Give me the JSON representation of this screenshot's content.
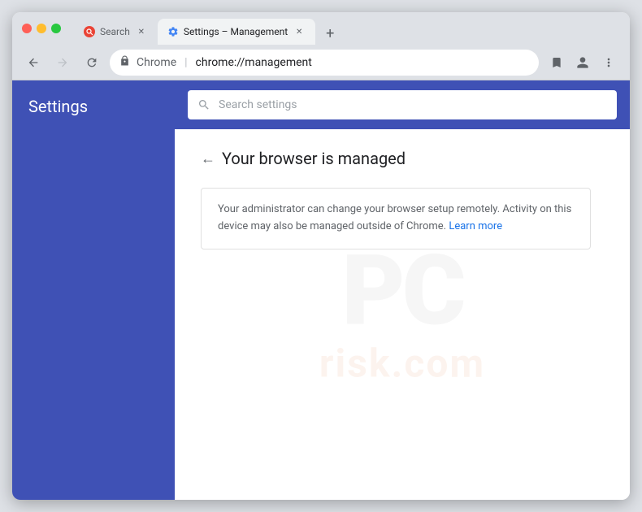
{
  "browser": {
    "tabs": [
      {
        "id": "search-tab",
        "label": "Search",
        "favicon": "search",
        "active": false,
        "closeable": true
      },
      {
        "id": "settings-tab",
        "label": "Settings – Management",
        "favicon": "settings",
        "active": true,
        "closeable": true
      }
    ],
    "new_tab_button": "+",
    "nav": {
      "back_disabled": false,
      "forward_disabled": true,
      "reload": true,
      "address": {
        "chrome_label": "Chrome",
        "separator": "|",
        "url": "chrome://management"
      }
    }
  },
  "sidebar": {
    "title": "Settings"
  },
  "settings_search": {
    "placeholder": "Search settings"
  },
  "management_page": {
    "back_label": "←",
    "heading": "Your browser is managed",
    "notice_text": "Your administrator can change your browser setup remotely. Activity on this device may also be managed outside of Chrome.",
    "learn_more_label": "Learn more"
  },
  "watermark": {
    "pc_text": "PC",
    "risk_text": "risk.com"
  }
}
